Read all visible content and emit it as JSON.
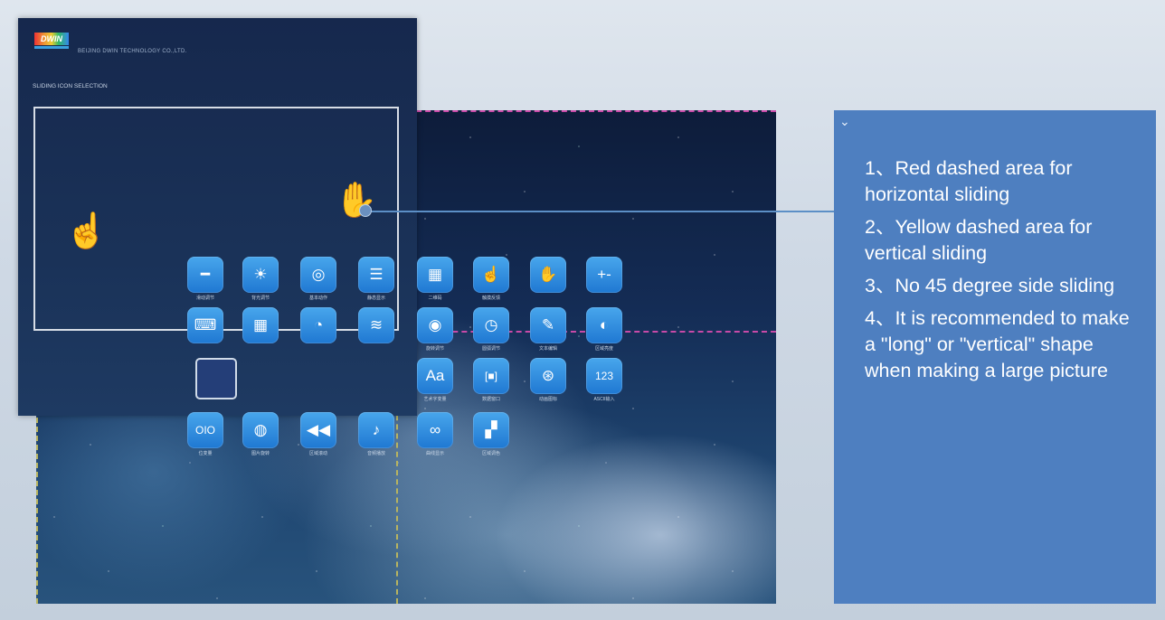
{
  "header": {
    "logo_text": "DWIN",
    "company": "BEIJING DWIN TECHNOLOGY CO.,LTD.",
    "section_title": "SLIDING ICON SELECTION"
  },
  "icons": [
    {
      "name": "slider-icon",
      "glyph": "━",
      "label": "滑动调节"
    },
    {
      "name": "brightness-icon",
      "glyph": "☀",
      "label": "背光调节"
    },
    {
      "name": "target-icon",
      "glyph": "◎",
      "label": "基本动作"
    },
    {
      "name": "list-icon",
      "glyph": "☰",
      "label": "静态显示"
    },
    {
      "name": "qr-code-icon",
      "glyph": "▦",
      "label": "二维码"
    },
    {
      "name": "touch-icon",
      "glyph": "☝",
      "label": "触摸反馈"
    },
    {
      "name": "gesture-icon",
      "glyph": "✋",
      "label": ""
    },
    {
      "name": "plus-minus-icon",
      "glyph": "+-",
      "label": ""
    },
    {
      "name": "keyboard-icon",
      "glyph": "⌨",
      "label": ""
    },
    {
      "name": "calendar-icon",
      "glyph": "▦",
      "label": ""
    },
    {
      "name": "chart-icon",
      "glyph": "◔",
      "label": ""
    },
    {
      "name": "wave-icon",
      "glyph": "≋",
      "label": ""
    },
    {
      "name": "rotate-icon",
      "glyph": "◉",
      "label": "旋转调节"
    },
    {
      "name": "gauge-icon",
      "glyph": "◷",
      "label": "圆弧调节"
    },
    {
      "name": "edit-icon",
      "glyph": "✎",
      "label": "文本编辑"
    },
    {
      "name": "contrast-icon",
      "glyph": "◐",
      "label": "区域亮度"
    },
    {
      "name": "font-icon",
      "glyph": "Aa",
      "label": "艺术字变量"
    },
    {
      "name": "scan-icon",
      "glyph": "[■]",
      "label": "数据窗口"
    },
    {
      "name": "film-icon",
      "glyph": "⊛",
      "label": "动画图标"
    },
    {
      "name": "abc-icon",
      "glyph": "123",
      "label": "ASCII输入"
    },
    {
      "name": "toggle-icon",
      "glyph": "OIO",
      "label": "位变量"
    },
    {
      "name": "fingerprint-icon",
      "glyph": "◍",
      "label": "图片旋转"
    },
    {
      "name": "rewind-icon",
      "glyph": "◀◀",
      "label": "区域滚动"
    },
    {
      "name": "music-icon",
      "glyph": "♪",
      "label": "音频播放"
    },
    {
      "name": "loop-icon",
      "glyph": "∞",
      "label": "曲线显示"
    },
    {
      "name": "color-grid-icon",
      "glyph": "▞",
      "label": "区域调色"
    }
  ],
  "info": {
    "items": [
      "1、Red dashed area for horizontal sliding",
      "2、Yellow dashed area for vertical sliding",
      "3、No 45 degree side sliding",
      "4、It is recommended to make a \"long\" or \"vertical\" shape when making a large picture"
    ]
  },
  "colors": {
    "horizontal_dash": "#c84aa8",
    "vertical_dash": "#b8b460",
    "info_panel": "#4e7fc0",
    "icon_blue": "#2a86dc"
  }
}
